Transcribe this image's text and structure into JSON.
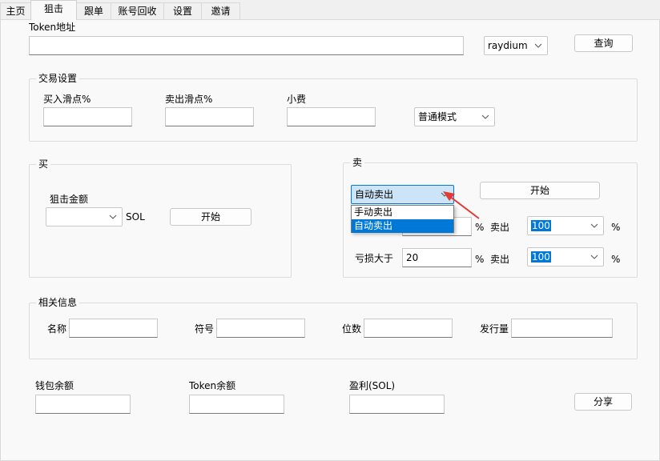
{
  "tabs": [
    "主页",
    "狙击",
    "跟单",
    "账号回收",
    "设置",
    "邀请"
  ],
  "token": {
    "label": "Token地址",
    "value": "",
    "dex_value": "raydium",
    "query_label": "查询"
  },
  "trade_settings": {
    "title": "交易设置",
    "buy_slippage_label": "买入滑点%",
    "buy_slippage_value": "",
    "sell_slippage_label": "卖出滑点%",
    "sell_slippage_value": "",
    "tip_label": "小费",
    "tip_value": "",
    "mode_value": "普通模式"
  },
  "buy": {
    "title": "买",
    "amount_label": "狙击金额",
    "amount_value": "",
    "unit": "SOL",
    "start_label": "开始"
  },
  "sell": {
    "title": "卖",
    "mode_value": "自动卖出",
    "start_label": "开始",
    "dropdown_options": [
      "手动卖出",
      "自动卖出"
    ],
    "row1": {
      "value": "",
      "percent": "%",
      "sell_label": "卖出",
      "sell_value": "100",
      "percent2": "%"
    },
    "row2": {
      "label": "亏损大于",
      "value": "20",
      "percent": "%",
      "sell_label": "卖出",
      "sell_value": "100",
      "percent2": "%"
    }
  },
  "info": {
    "title": "相关信息",
    "name_label": "名称",
    "symbol_label": "符号",
    "decimals_label": "位数",
    "supply_label": "发行量",
    "name_value": "",
    "symbol_value": "",
    "decimals_value": "",
    "supply_value": ""
  },
  "footer": {
    "wallet_label": "钱包余额",
    "token_balance_label": "Token余额",
    "profit_label": "盈利(SOL)",
    "wallet_value": "",
    "token_balance_value": "",
    "profit_value": "",
    "share_label": "分享"
  },
  "colors": {
    "selection": "#0078d7",
    "arrow": "#e53935"
  }
}
